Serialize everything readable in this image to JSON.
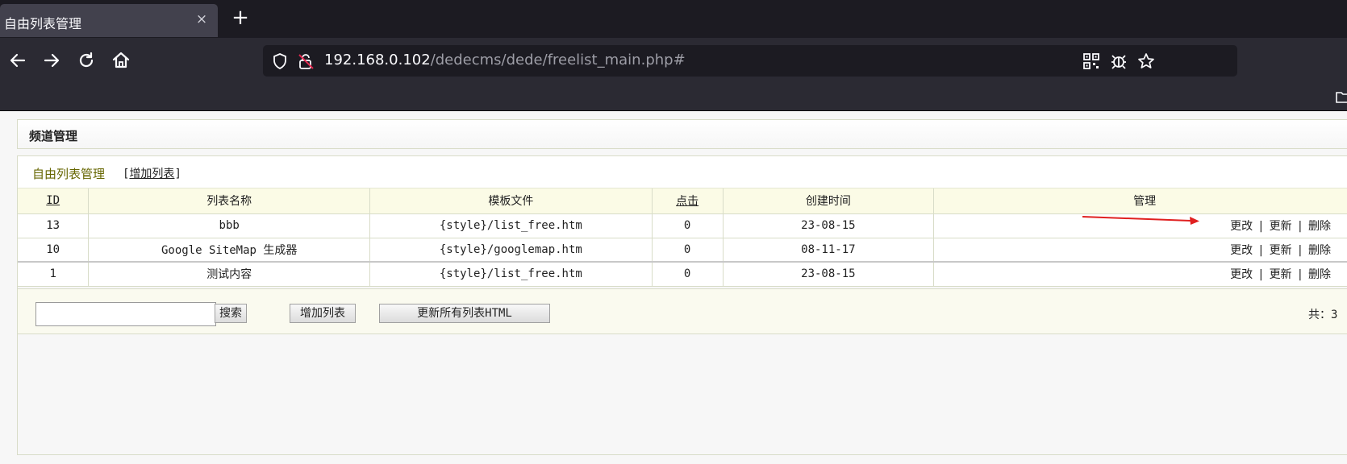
{
  "browser": {
    "tab_title": "自由列表管理",
    "tab_close": "×",
    "new_tab": "+",
    "url_host": "192.168.0.102",
    "url_path": "/dedecms/dede/freelist_main.php#"
  },
  "page": {
    "channel_title": "频道管理",
    "section_title": "自由列表管理",
    "add_link_prefix": "[",
    "add_link_label": "增加列表",
    "add_link_suffix": "]"
  },
  "table": {
    "headers": [
      "ID",
      "列表名称",
      "模板文件",
      "点击",
      "创建时间",
      "管理"
    ],
    "rows": [
      {
        "id": "13",
        "name": "bbb",
        "template": "{style}/list_free.htm",
        "clicks": "0",
        "created": "23-08-15"
      },
      {
        "id": "10",
        "name": "Google SiteMap 生成器",
        "template": "{style}/googlemap.htm",
        "clicks": "0",
        "created": "08-11-17"
      },
      {
        "id": "1",
        "name": "测试内容",
        "template": "{style}/list_free.htm",
        "clicks": "0",
        "created": "23-08-15"
      }
    ],
    "actions": {
      "edit": "更改",
      "update": "更新",
      "delete": "删除",
      "separator": "|"
    }
  },
  "footer": {
    "search_value": "",
    "search_button": "搜索",
    "add_button": "增加列表",
    "update_all_button": "更新所有列表HTML",
    "total_text": "共：3"
  },
  "colors": {
    "section_title": "#666600",
    "header_bg": "#fbfbe6",
    "annotation_arrow": "#e02020"
  }
}
